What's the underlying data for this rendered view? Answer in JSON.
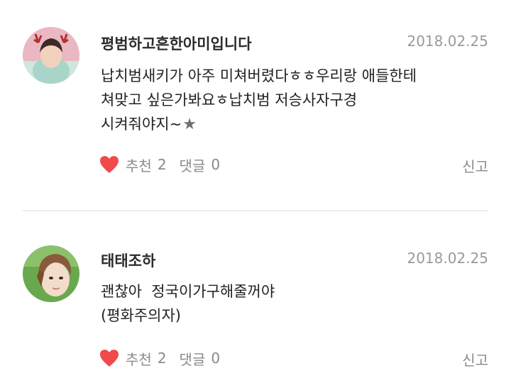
{
  "comments": [
    {
      "username": "평범하고흔한아미입니다",
      "date": "2018.02.25",
      "lines": [
        "납치범새키가 아주 미쳐버렸다ㅎㅎ우리랑 애들한테",
        "쳐맞고 싶은가봐요ㅎ납치범 저승사자구경",
        "시켜줘야지~"
      ],
      "recommend_label": "추천",
      "recommend_count": "2",
      "reply_label": "댓글",
      "reply_count": "0",
      "report_label": "신고"
    },
    {
      "username": "태태조하",
      "date": "2018.02.25",
      "lines": [
        "괜찮아  정국이가구해줄꺼야",
        "(평화주의자)"
      ],
      "recommend_label": "추천",
      "recommend_count": "2",
      "reply_label": "댓글",
      "reply_count": "0",
      "report_label": "신고"
    }
  ],
  "icons": {
    "like": "heart-icon",
    "emoji": "star-icon"
  },
  "colors": {
    "heart": "#f04a4a",
    "date": "#9a9a9a",
    "divider": "#e8eeee"
  }
}
